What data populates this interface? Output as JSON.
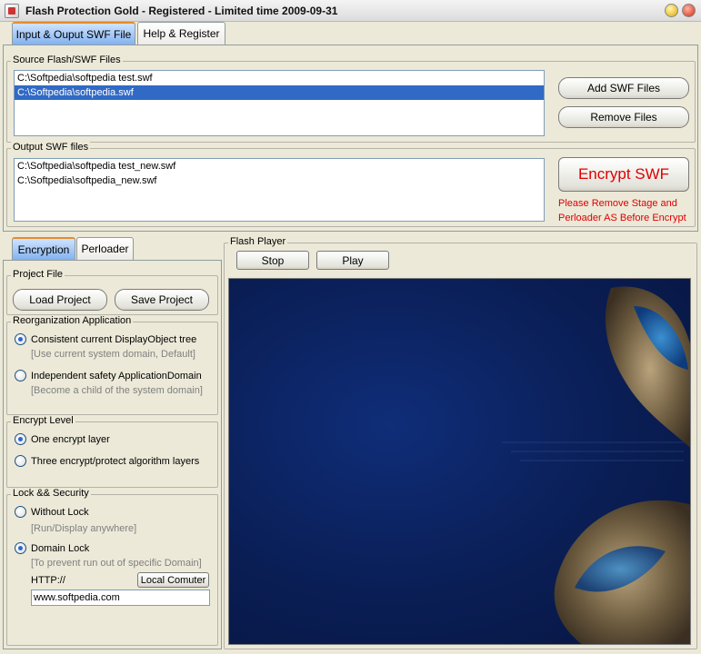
{
  "window": {
    "title": "Flash Protection Gold - Registered - Limited time 2009-09-31"
  },
  "tabs": [
    {
      "label": "Input & Ouput SWF File",
      "active": true
    },
    {
      "label": "Help & Register",
      "active": false
    }
  ],
  "source": {
    "legend": "Source Flash/SWF Files",
    "files": [
      "C:\\Softpedia\\softpedia test.swf",
      "C:\\Softpedia\\softpedia.swf"
    ],
    "selected_index": 1,
    "add_label": "Add SWF Files",
    "remove_label": "Remove Files"
  },
  "output": {
    "legend": "Output SWF files",
    "files": [
      "C:\\Softpedia\\softpedia test_new.swf",
      "C:\\Softpedia\\softpedia_new.swf"
    ],
    "encrypt_label": "Encrypt SWF",
    "warning_line1": "Please Remove Stage and",
    "warning_line2": "Perloader AS Before Encrypt"
  },
  "left_tabs": [
    {
      "label": "Encryption",
      "active": true
    },
    {
      "label": "Perloader",
      "active": false
    }
  ],
  "project": {
    "legend": "Project File",
    "load_label": "Load Project",
    "save_label": "Save Project"
  },
  "reorg": {
    "legend": "Reorganization Application",
    "opt1": "Consistent current DisplayObject tree",
    "opt1_hint": "[Use current system domain, Default]",
    "opt2": "Independent safety ApplicationDomain",
    "opt2_hint": "[Become a child of the system domain]",
    "selected": 1
  },
  "encrypt_level": {
    "legend": "Encrypt Level",
    "opt1": "One encrypt layer",
    "opt2": "Three encrypt/protect algorithm layers",
    "selected": 1
  },
  "lock": {
    "legend": "Lock && Security",
    "opt1": "Without Lock",
    "opt1_hint": "[Run/Display anywhere]",
    "opt2": "Domain Lock",
    "opt2_hint": "[To prevent run out of specific Domain]",
    "selected": 2,
    "http_label": "HTTP://",
    "local_button": "Local Comuter",
    "domain_value": "www.softpedia.com"
  },
  "player": {
    "legend": "Flash Player",
    "stop_label": "Stop",
    "play_label": "Play"
  },
  "colors": {
    "accent": "#316ac5",
    "warning": "#e00000",
    "tab_highlight": "#e68b2c"
  }
}
